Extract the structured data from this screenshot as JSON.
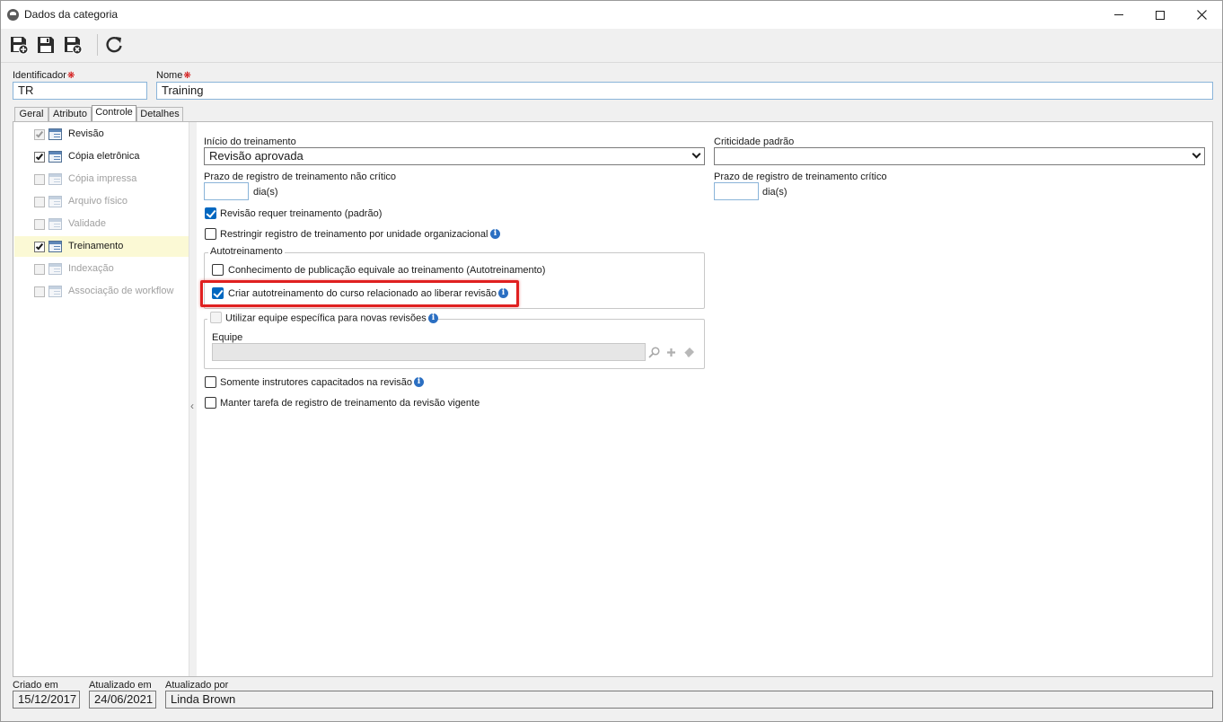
{
  "window": {
    "title": "Dados da categoria",
    "icon": "globe-icon",
    "controls": [
      "minimize-icon",
      "maximize-icon",
      "close-icon"
    ]
  },
  "toolbar": {
    "buttons": [
      {
        "name": "save-new",
        "icon": "save-new-icon"
      },
      {
        "name": "save",
        "icon": "save-icon"
      },
      {
        "name": "save-close",
        "icon": "save-close-icon"
      },
      {
        "name": "refresh",
        "icon": "refresh-icon"
      }
    ]
  },
  "header": {
    "identifier_label": "Identificador",
    "identifier_value": "TR",
    "name_label": "Nome",
    "name_value": "Training",
    "required_mark": "❋"
  },
  "tabs": [
    {
      "label": "Geral",
      "active": false
    },
    {
      "label": "Atributo",
      "active": false
    },
    {
      "label": "Controle",
      "active": true
    },
    {
      "label": "Detalhes",
      "active": false
    }
  ],
  "controls_list": [
    {
      "label": "Revisão",
      "checked": true,
      "enabled": false,
      "selected": false
    },
    {
      "label": "Cópia eletrônica",
      "checked": true,
      "enabled": true,
      "selected": false
    },
    {
      "label": "Cópia impressa",
      "checked": false,
      "enabled": false,
      "selected": false
    },
    {
      "label": "Arquivo físico",
      "checked": false,
      "enabled": false,
      "selected": false
    },
    {
      "label": "Validade",
      "checked": false,
      "enabled": false,
      "selected": false
    },
    {
      "label": "Treinamento",
      "checked": true,
      "enabled": true,
      "selected": true
    },
    {
      "label": "Indexação",
      "checked": false,
      "enabled": false,
      "selected": false
    },
    {
      "label": "Associação de workflow",
      "checked": false,
      "enabled": false,
      "selected": false
    }
  ],
  "training": {
    "start_label": "Início do treinamento",
    "start_value": "Revisão aprovada",
    "criticality_label": "Criticidade padrão",
    "criticality_value": "",
    "noncritical_deadline_label": "Prazo de registro de treinamento não crítico",
    "critical_deadline_label": "Prazo de registro de treinamento crítico",
    "days_unit": "dia(s)",
    "revision_requires_label": "Revisão requer treinamento (padrão)",
    "revision_requires_checked": true,
    "restrict_label": "Restringir registro de treinamento por unidade organizacional",
    "restrict_checked": false,
    "self_training_group": "Autotreinamento",
    "knowledge_label": "Conhecimento de publicação equivale ao treinamento (Autotreinamento)",
    "knowledge_checked": false,
    "create_self_label": "Criar autotreinamento do curso relacionado ao liberar revisão",
    "create_self_checked": true,
    "team_group_label": "Utilizar equipe específica para novas revisões",
    "team_group_checked": false,
    "team_label": "Equipe",
    "team_value": "",
    "only_instructors_label": "Somente instrutores capacitados na revisão",
    "only_instructors_checked": false,
    "keep_task_label": "Manter tarefa de registro de treinamento da revisão vigente",
    "keep_task_checked": false
  },
  "footer": {
    "created_label": "Criado em",
    "created_value": "15/12/2017",
    "updated_label": "Atualizado em",
    "updated_value": "24/06/2021",
    "updated_by_label": "Atualizado por",
    "updated_by_value": "Linda Brown"
  },
  "colors": {
    "accent": "#0067c0",
    "highlight_border": "#e02020",
    "selected_row": "#fbf9d5",
    "info_icon": "#2b6fc2"
  }
}
